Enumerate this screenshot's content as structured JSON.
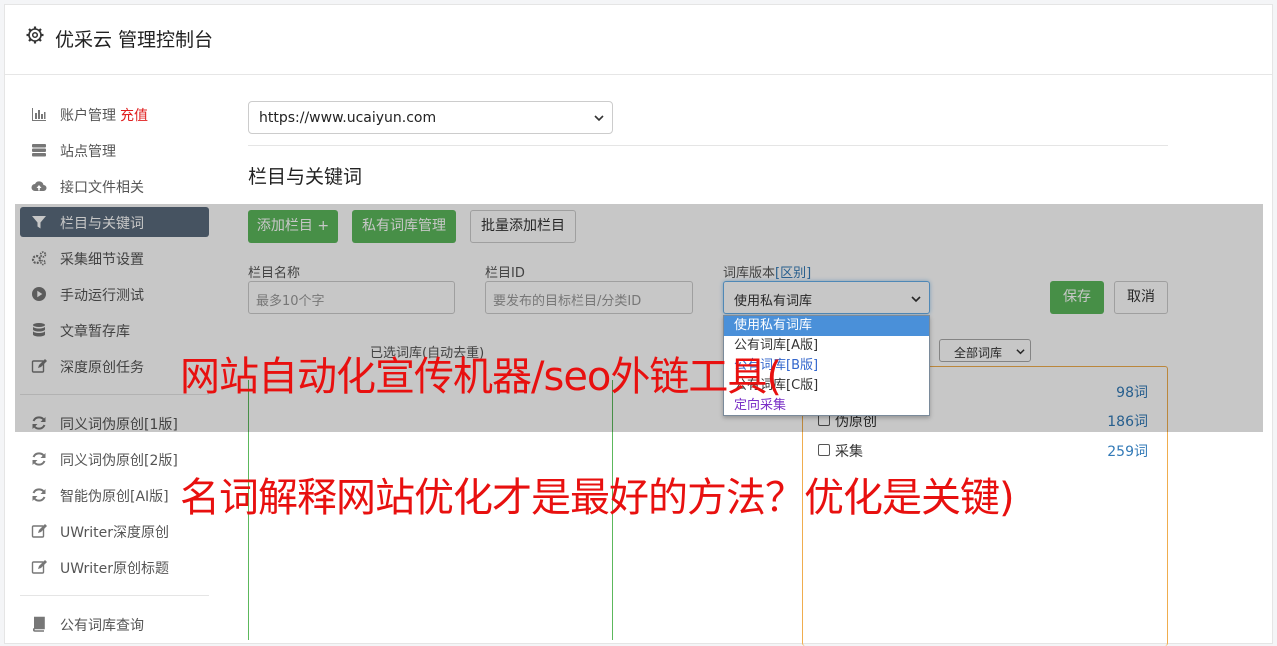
{
  "header": {
    "title": "优采云 管理控制台",
    "icon": "gear-icon"
  },
  "sidebar": {
    "items": [
      {
        "label": "账户管理",
        "badge": "充值",
        "icon": "bar-chart-icon"
      },
      {
        "label": "站点管理",
        "icon": "server-icon"
      },
      {
        "label": "接口文件相关",
        "icon": "cloud-upload-icon"
      },
      {
        "label": "栏目与关键词",
        "icon": "filter-icon",
        "active": true
      },
      {
        "label": "采集细节设置",
        "icon": "cogs-icon"
      },
      {
        "label": "手动运行测试",
        "icon": "play-circle-icon"
      },
      {
        "label": "文章暂存库",
        "icon": "database-icon"
      },
      {
        "label": "深度原创任务",
        "icon": "edit-icon"
      },
      {
        "label": "同义词伪原创[1版]",
        "icon": "refresh-icon"
      },
      {
        "label": "同义词伪原创[2版]",
        "icon": "refresh-icon"
      },
      {
        "label": "智能伪原创[AI版]",
        "icon": "refresh-icon"
      },
      {
        "label": "UWriter深度原创",
        "icon": "edit-icon"
      },
      {
        "label": "UWriter原创标题",
        "icon": "edit-icon"
      },
      {
        "label": "公有词库查询",
        "icon": "book-icon"
      }
    ]
  },
  "main": {
    "site_select_value": "https://www.ucaiyun.com",
    "section_title": "栏目与关键词",
    "buttons": {
      "add_column": "添加栏目 +",
      "private_lib": "私有词库管理",
      "batch_add": "批量添加栏目",
      "save": "保存",
      "cancel": "取消"
    },
    "form": {
      "name_label": "栏目名称",
      "name_placeholder": "最多10个字",
      "id_label": "栏目ID",
      "id_placeholder": "要发布的目标栏目/分类ID",
      "version_label": "词库版本",
      "version_link": "[区别]",
      "version_value": "使用私有词库"
    },
    "dropdown_options": [
      "使用私有词库",
      "公有词库[A版]",
      "公有词库[B版]",
      "公有词库[C版]",
      "定向采集"
    ],
    "selected_words_label": "已选词库(自动去重)",
    "library_filter": "全部词库",
    "libraries": [
      {
        "name": "",
        "count": "98词"
      },
      {
        "name": "伪原创",
        "count": "186词"
      },
      {
        "name": "采集",
        "count": "259词"
      }
    ]
  },
  "watermark": {
    "line1": "网站自动化宣传机器/seo外链工具(",
    "line2": "名词解释网站优化才是最好的方法？优化是关键)"
  },
  "colors": {
    "accent_green": "#5cb85c",
    "active_nav": "#5a6b7d",
    "watermark": "#e8100f",
    "link": "#337ab7"
  }
}
